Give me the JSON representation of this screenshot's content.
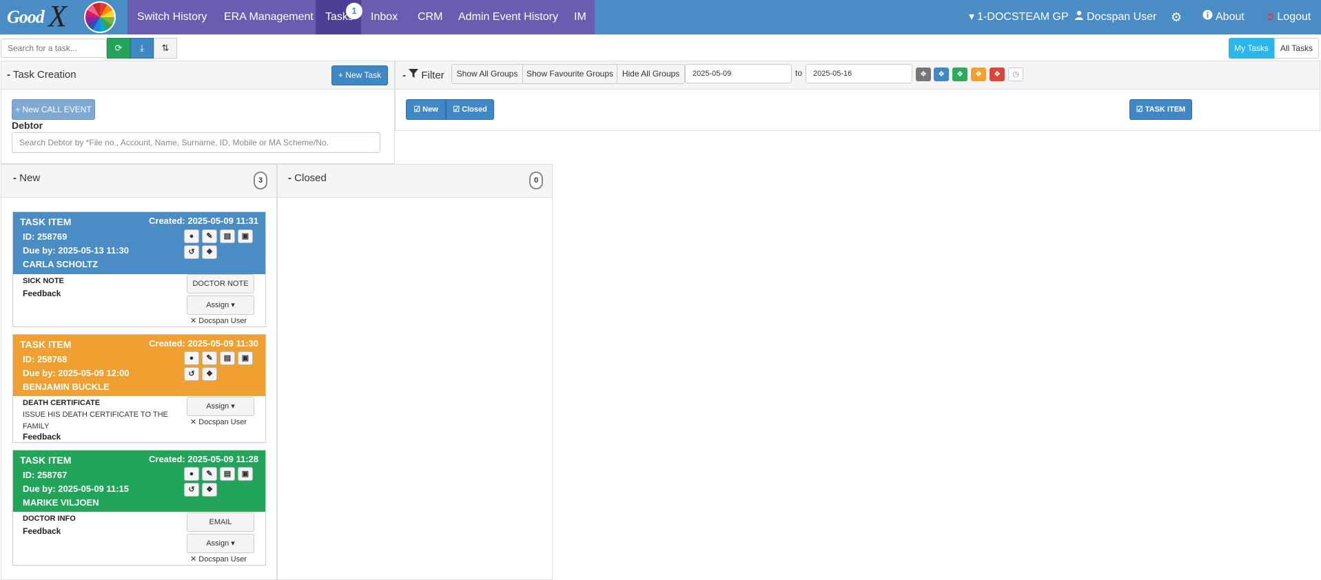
{
  "brand": {
    "logo_text": "Good",
    "logo_x": "X"
  },
  "nav": {
    "items": [
      "Switch History",
      "ERA Management",
      "Tasks",
      "Inbox",
      "CRM",
      "Admin Event History",
      "IM"
    ],
    "tasks_badge": "1",
    "practice": "1-DOCSTEAM GP",
    "user": "Docspan User",
    "about": "About",
    "logout": "Logout"
  },
  "toolbar": {
    "search_placeholder": "Search for a task...",
    "my_tasks": "My Tasks",
    "all_tasks": "All Tasks"
  },
  "task_creation": {
    "title": "Task Creation",
    "new_task": "New Task",
    "new_call_event": "New CALL EVENT",
    "debtor_label": "Debtor",
    "debtor_placeholder": "Search Debtor by *File no., Account, Name, Surname, ID, Mobile or MA Scheme/No."
  },
  "filter": {
    "title": "Filter",
    "show_all_groups": "Show All Groups",
    "show_favourite_groups": "Show Favourite Groups",
    "hide_all_groups": "Hide All Groups",
    "date_from": "2025-05-09",
    "to_label": "to",
    "date_to": "2025-05-16",
    "status_new": "New",
    "status_closed": "Closed",
    "task_item": "TASK ITEM",
    "tag_colors": [
      "#777777",
      "#3f88c5",
      "#2eaa5e",
      "#f0a030",
      "#d9463a"
    ]
  },
  "columns": {
    "new": {
      "title": "New",
      "count": "3"
    },
    "closed": {
      "title": "Closed",
      "count": "0"
    }
  },
  "tasks": [
    {
      "title": "TASK ITEM",
      "created": "Created:  2025-05-09 11:31",
      "id": "ID: 258769",
      "due": "Due by:  2025-05-13 11:30",
      "name": "CARLA SCHOLTZ",
      "type": "SICK NOTE",
      "description": "",
      "feedback": "Feedback",
      "action_button": "DOCTOR NOTE",
      "assign": "Assign ▾",
      "assigned_user": "✕ Docspan User",
      "color": "#4a8cc4"
    },
    {
      "title": "TASK ITEM",
      "created": "Created:  2025-05-09 11:30",
      "id": "ID: 258768",
      "due": "Due by:  2025-05-09 12:00",
      "name": "BENJAMIN BUCKLE",
      "type": "DEATH CERTIFICATE",
      "description": "ISSUE HIS DEATH CERTIFICATE TO THE FAMILY",
      "feedback": "Feedback",
      "action_button": "",
      "assign": "Assign ▾",
      "assigned_user": "✕ Docspan User",
      "color": "#f0a030"
    },
    {
      "title": "TASK ITEM",
      "created": "Created:  2025-05-09 11:28",
      "id": "ID: 258767",
      "due": "Due by:  2025-05-09 11:15",
      "name": "MARIKE VILJOEN",
      "type": "DOCTOR INFO",
      "description": "",
      "feedback": "Feedback",
      "action_button": "EMAIL",
      "assign": "Assign ▾",
      "assigned_user": "✕ Docspan User",
      "color": "#22a55a"
    }
  ]
}
